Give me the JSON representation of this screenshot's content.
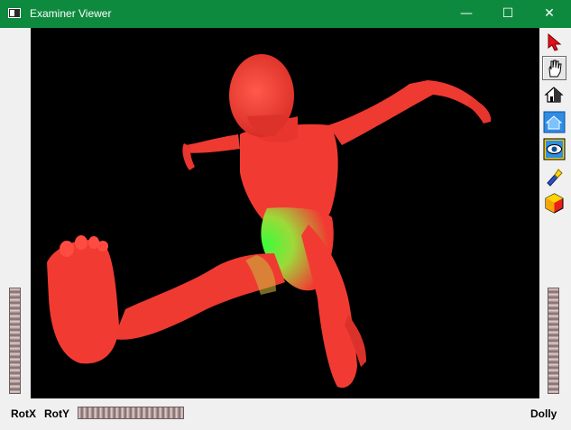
{
  "window": {
    "title": "Examiner Viewer",
    "controls": {
      "minimize": "—",
      "maximize": "☐",
      "close": "✕"
    }
  },
  "toolbar": {
    "items": [
      {
        "icon": "select-arrow-icon",
        "active": false
      },
      {
        "icon": "hand-view-icon",
        "active": true
      },
      {
        "icon": "home-icon",
        "active": false
      },
      {
        "icon": "set-home-icon",
        "active": false
      },
      {
        "icon": "view-all-icon",
        "active": false
      },
      {
        "icon": "seek-flashlight-icon",
        "active": false
      },
      {
        "icon": "projection-cube-icon",
        "active": false
      }
    ]
  },
  "bottom_bar": {
    "rotx_label": "RotX",
    "roty_label": "RotY",
    "dolly_label": "Dolly"
  },
  "colors": {
    "titlebar": "#0e8a3f",
    "model_red": "#f13b32",
    "model_green": "#3dfb3a",
    "viewport_bg": "#000000"
  }
}
